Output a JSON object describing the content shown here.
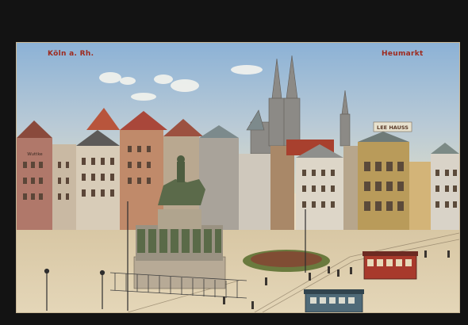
{
  "postcard": {
    "city_caption": "Köln a. Rh.",
    "place_caption": "Heumarkt",
    "rooftop_sign": "LEE HAUSS",
    "facade_sign": "Wuttke"
  },
  "colors": {
    "sky_top": "#8fb3d4",
    "sky_bottom": "#d8dccd",
    "caption_red": "#9e2a1e",
    "square_paving": "#d9c9a9",
    "tram_red": "#a83a2c"
  }
}
